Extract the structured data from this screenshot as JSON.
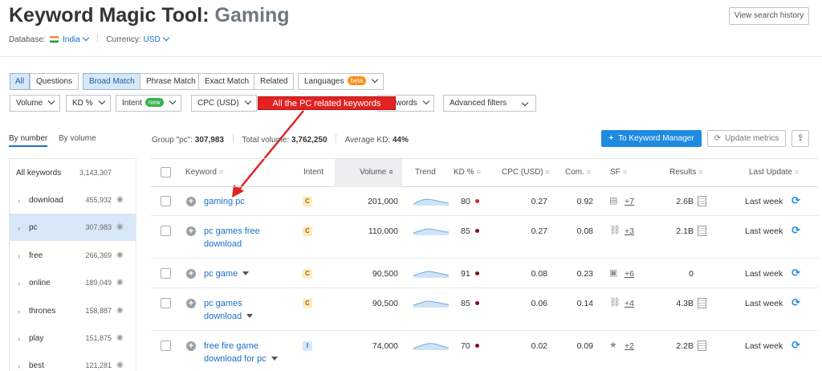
{
  "header": {
    "title_main": "Keyword Magic Tool:",
    "title_keyword": "Gaming",
    "history_button": "View search history",
    "database_label": "Database:",
    "database_value": "India",
    "currency_label": "Currency:",
    "currency_value": "USD"
  },
  "filters": {
    "row1": [
      {
        "label": "All",
        "active": true
      },
      {
        "label": "Questions",
        "active": false
      },
      {
        "label": "Broad Match",
        "active": true
      },
      {
        "label": "Phrase Match",
        "active": false
      },
      {
        "label": "Exact Match",
        "active": false
      },
      {
        "label": "Related",
        "active": false
      }
    ],
    "languages_label": "Languages",
    "languages_badge": "beta",
    "volume": "Volume",
    "kd": "KD %",
    "intent": "Intent",
    "intent_badge": "new",
    "cpc": "CPC (USD)",
    "keywords_partial": "words",
    "advanced": "Advanced filters"
  },
  "annotation": "All the PC related keywords",
  "sort_tabs": {
    "by_number": "By number",
    "by_volume": "By volume"
  },
  "summary": {
    "group_label": "Group \"pc\":",
    "group_value": "307,983",
    "total_label": "Total volume:",
    "total_value": "3,762,250",
    "kd_label": "Average KD:",
    "kd_value": "44%"
  },
  "actions": {
    "keyword_manager": "To Keyword Manager",
    "update_metrics": "Update metrics"
  },
  "sidebar": {
    "all_label": "All keywords",
    "all_count": "3,143,307",
    "items": [
      {
        "label": "download",
        "count": "455,932"
      },
      {
        "label": "pc",
        "count": "307,983",
        "selected": true
      },
      {
        "label": "free",
        "count": "266,369"
      },
      {
        "label": "online",
        "count": "189,049"
      },
      {
        "label": "thrones",
        "count": "158,887"
      },
      {
        "label": "play",
        "count": "151,875"
      },
      {
        "label": "best",
        "count": "121,281"
      }
    ]
  },
  "table": {
    "headers": {
      "keyword": "Keyword",
      "intent": "Intent",
      "volume": "Volume",
      "trend": "Trend",
      "kd": "KD %",
      "cpc": "CPC (USD)",
      "com": "Com.",
      "sf": "SF",
      "results": "Results",
      "last_update": "Last Update"
    },
    "rows": [
      {
        "keyword_line1": "gaming pc",
        "keyword_line2": "",
        "intent": "C",
        "volume": "201,000",
        "kd": "80",
        "kd_color": "#e02424",
        "cpc": "0.27",
        "com": "0.92",
        "sf_icon": "▤",
        "sf_count": "+7",
        "results": "2.6B",
        "last_update": "Last week"
      },
      {
        "keyword_line1": "pc games free",
        "keyword_line2": "download",
        "intent": "C",
        "volume": "110,000",
        "kd": "85",
        "kd_color": "#8b0a1a",
        "cpc": "0.27",
        "com": "0.08",
        "sf_icon": "🔗",
        "sf_count": "+3",
        "results": "2.1B",
        "last_update": "Last week"
      },
      {
        "keyword_line1": "pc game",
        "keyword_line2": "",
        "intent": "C",
        "volume": "90,500",
        "kd": "91",
        "kd_color": "#8b0a1a",
        "cpc": "0.08",
        "com": "0.23",
        "sf_icon": "▣",
        "sf_count": "+6",
        "results": "0",
        "last_update": "Last week"
      },
      {
        "keyword_line1": "pc games",
        "keyword_line2": "download",
        "intent": "C",
        "volume": "90,500",
        "kd": "85",
        "kd_color": "#8b0a1a",
        "cpc": "0.06",
        "com": "0.14",
        "sf_icon": "🔗",
        "sf_count": "+4",
        "results": "4.3B",
        "last_update": "Last week"
      },
      {
        "keyword_line1": "free fire game",
        "keyword_line2": "download for pc",
        "intent": "I",
        "volume": "74,000",
        "kd": "70",
        "kd_color": "#8b0a1a",
        "cpc": "0.02",
        "com": "0.09",
        "sf_icon": "★",
        "sf_count": "+2",
        "results": "2.2B",
        "last_update": "Last week"
      }
    ]
  },
  "colors": {
    "accent": "#1e8ae0",
    "link": "#1a6fc9",
    "callout": "#e32222",
    "selected_bg": "#d8e7f7"
  }
}
